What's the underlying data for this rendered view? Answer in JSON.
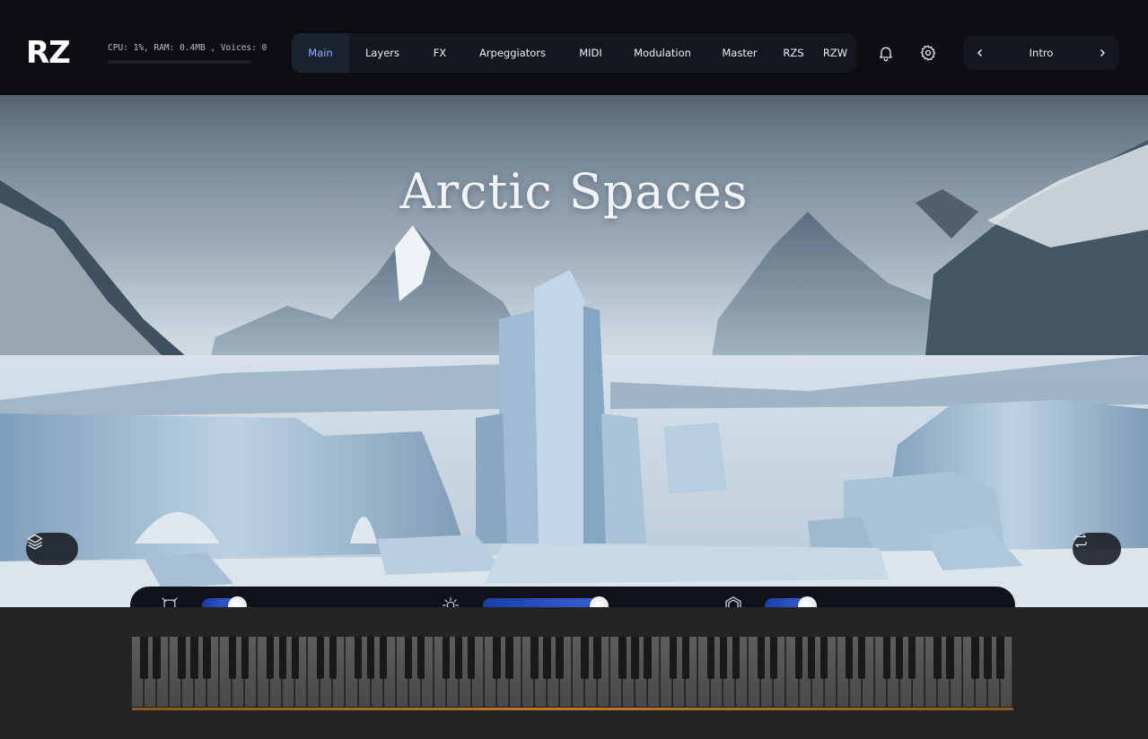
{
  "app": {
    "logo": "RZ",
    "stats": "CPU: 1%, RAM: 0.4MB , Voices: 0"
  },
  "nav": {
    "tabs": [
      {
        "label": "Main",
        "active": true
      },
      {
        "label": "Layers",
        "active": false
      },
      {
        "label": "FX",
        "active": false
      },
      {
        "label": "Arpeggiators",
        "active": false
      },
      {
        "label": "MIDI",
        "active": false
      },
      {
        "label": "Modulation",
        "active": false
      },
      {
        "label": "Master",
        "active": false
      },
      {
        "label": "RZS",
        "active": false
      },
      {
        "label": "RZW",
        "active": false
      }
    ]
  },
  "header_icons": {
    "notifications": "bell-icon",
    "settings": "gear-icon"
  },
  "preset": {
    "name": "Intro",
    "prev_icon": "chevron-left-icon",
    "next_icon": "chevron-right-icon"
  },
  "scene": {
    "title": "Arctic Spaces",
    "layers_icon": "layers-icon",
    "cycle_icon": "repeat-icon"
  },
  "controls": {
    "sliders": [
      {
        "icon": "frame-icon",
        "value": 0.7
      },
      {
        "icon": "sun-icon",
        "value": 0.98
      },
      {
        "icon": "hexagon-icon",
        "value": 0.75
      }
    ]
  },
  "colors": {
    "accent": "#8fb0ff",
    "slider": "#2a4fc4",
    "keyboard_strip": "#c17b26"
  }
}
